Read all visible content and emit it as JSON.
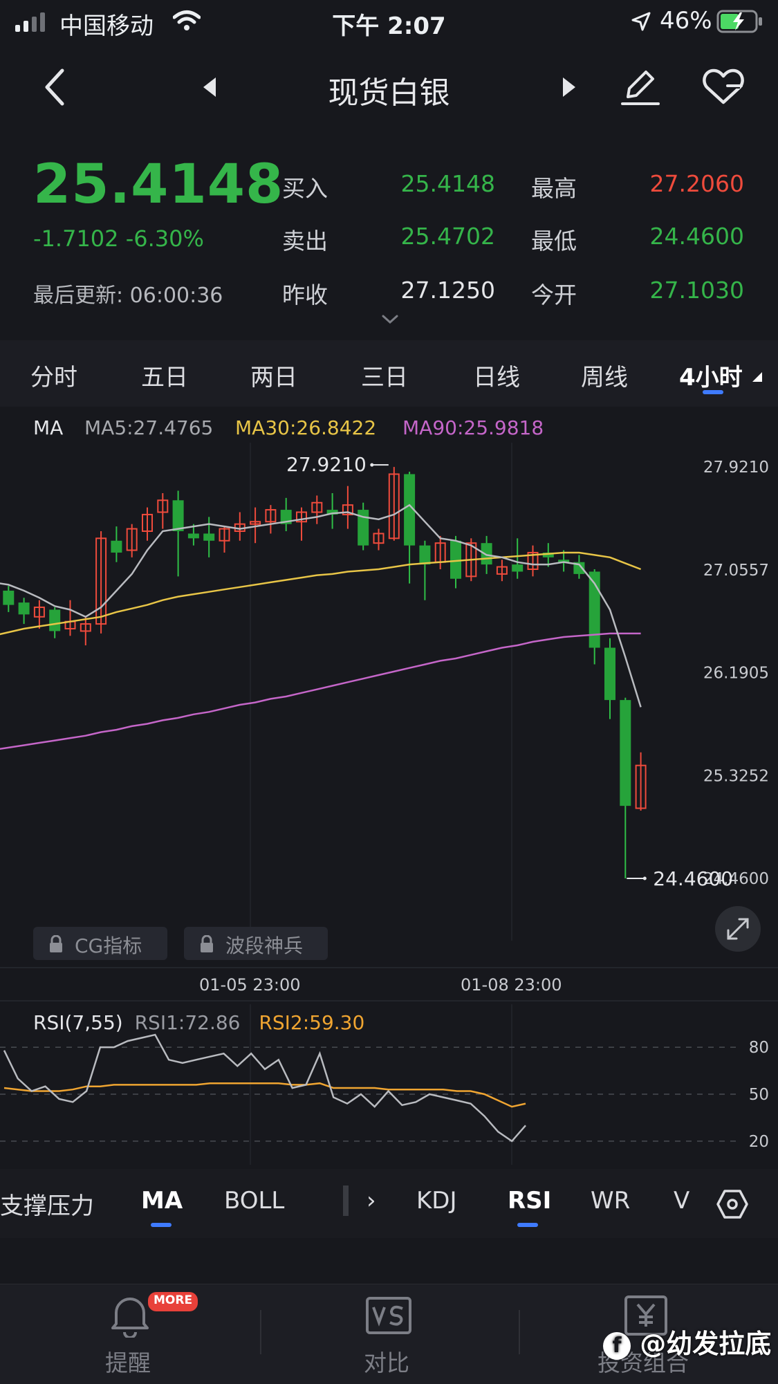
{
  "status_bar": {
    "carrier": "中国移动",
    "time": "下午 2:07",
    "battery": "46%"
  },
  "nav": {
    "title": "现货白银"
  },
  "quote": {
    "price": "25.4148",
    "change": "-1.7102",
    "change_pct": "-6.30%",
    "last_update_label": "最后更新:",
    "last_update_time": "06:00:36",
    "rows": [
      {
        "l1": "买入",
        "v1": "25.4148",
        "c1": "#35b54a",
        "l2": "最高",
        "v2": "27.2060",
        "c2": "#ef4b3c"
      },
      {
        "l1": "卖出",
        "v1": "25.4702",
        "c1": "#35b54a",
        "l2": "最低",
        "v2": "24.4600",
        "c2": "#35b54a"
      },
      {
        "l1": "昨收",
        "v1": "27.1250",
        "c1": "#e6e7ea",
        "l2": "今开",
        "v2": "27.1030",
        "c2": "#35b54a"
      }
    ]
  },
  "tabs": [
    "分时",
    "五日",
    "两日",
    "三日",
    "日线",
    "周线",
    "4小时"
  ],
  "ma_legend": {
    "label": "MA",
    "ma5": "MA5:27.4765",
    "ma30": "MA30:26.8422",
    "ma90": "MA90:25.9818",
    "colors": {
      "ma5": "#b9bbc0",
      "ma30": "#e8c547",
      "ma90": "#c566c9"
    }
  },
  "chart_data": {
    "type": "candlestick",
    "y_ticks": [
      "27.9210",
      "27.0557",
      "26.1905",
      "25.3252",
      "24.4600"
    ],
    "max_label": "27.9210",
    "min_label": "24.4600",
    "x_labels": [
      "01-05 23:00",
      "01-08 23:00"
    ],
    "up_color": "#ef4b3c",
    "down_color": "#26a33a",
    "candles": [
      [
        27.04,
        27.06,
        26.78,
        26.88
      ],
      [
        26.88,
        26.92,
        26.7,
        26.76
      ],
      [
        26.78,
        26.82,
        26.6,
        26.68
      ],
      [
        26.66,
        26.8,
        26.56,
        26.74
      ],
      [
        26.72,
        26.74,
        26.48,
        26.54
      ],
      [
        26.56,
        26.8,
        26.5,
        26.62
      ],
      [
        26.54,
        26.66,
        26.42,
        26.6
      ],
      [
        26.6,
        27.38,
        26.52,
        27.32
      ],
      [
        27.3,
        27.42,
        27.12,
        27.2
      ],
      [
        27.22,
        27.44,
        27.16,
        27.4
      ],
      [
        27.38,
        27.58,
        27.3,
        27.52
      ],
      [
        27.54,
        27.7,
        27.4,
        27.64
      ],
      [
        27.64,
        27.72,
        27.0,
        27.38
      ],
      [
        27.36,
        27.44,
        27.26,
        27.32
      ],
      [
        27.36,
        27.5,
        27.16,
        27.3
      ],
      [
        27.3,
        27.42,
        27.2,
        27.4
      ],
      [
        27.38,
        27.54,
        27.3,
        27.44
      ],
      [
        27.44,
        27.58,
        27.28,
        27.46
      ],
      [
        27.46,
        27.6,
        27.36,
        27.56
      ],
      [
        27.56,
        27.66,
        27.38,
        27.44
      ],
      [
        27.46,
        27.58,
        27.3,
        27.54
      ],
      [
        27.54,
        27.68,
        27.44,
        27.62
      ],
      [
        27.56,
        27.7,
        27.4,
        27.52
      ],
      [
        27.52,
        27.76,
        27.4,
        27.6
      ],
      [
        27.56,
        27.62,
        27.22,
        27.26
      ],
      [
        27.28,
        27.4,
        27.22,
        27.36
      ],
      [
        27.32,
        27.92,
        27.3,
        27.86
      ],
      [
        27.86,
        27.88,
        26.94,
        27.26
      ],
      [
        27.26,
        27.3,
        26.8,
        27.1
      ],
      [
        27.12,
        27.34,
        27.06,
        27.28
      ],
      [
        27.3,
        27.34,
        26.9,
        26.98
      ],
      [
        27.0,
        27.32,
        26.96,
        27.28
      ],
      [
        27.28,
        27.34,
        27.02,
        27.1
      ],
      [
        27.02,
        27.14,
        26.96,
        27.08
      ],
      [
        27.1,
        27.32,
        26.98,
        27.04
      ],
      [
        27.06,
        27.26,
        27.0,
        27.2
      ],
      [
        27.2,
        27.28,
        27.08,
        27.16
      ],
      [
        27.14,
        27.22,
        27.04,
        27.12
      ],
      [
        27.12,
        27.18,
        26.98,
        27.02
      ],
      [
        27.04,
        27.06,
        26.26,
        26.4
      ],
      [
        26.4,
        26.48,
        25.8,
        25.96
      ],
      [
        25.96,
        25.98,
        24.46,
        25.07
      ],
      [
        25.05,
        25.52,
        25.03,
        25.41
      ]
    ],
    "ma5": [
      26.95,
      26.93,
      26.88,
      26.82,
      26.75,
      26.72,
      26.66,
      26.74,
      26.88,
      27.02,
      27.22,
      27.38,
      27.4,
      27.42,
      27.44,
      27.42,
      27.4,
      27.42,
      27.44,
      27.46,
      27.48,
      27.5,
      27.53,
      27.54,
      27.5,
      27.48,
      27.52,
      27.6,
      27.46,
      27.32,
      27.3,
      27.26,
      27.18,
      27.16,
      27.12,
      27.1,
      27.1,
      27.12,
      27.1,
      26.94,
      26.72,
      26.32,
      25.9
    ],
    "ma30": [
      26.5,
      26.53,
      26.56,
      26.58,
      26.6,
      26.62,
      26.64,
      26.66,
      26.7,
      26.73,
      26.76,
      26.8,
      26.83,
      26.85,
      26.87,
      26.89,
      26.91,
      26.93,
      26.95,
      26.97,
      26.99,
      27.01,
      27.02,
      27.04,
      27.05,
      27.06,
      27.08,
      27.1,
      27.11,
      27.12,
      27.13,
      27.14,
      27.15,
      27.16,
      27.17,
      27.18,
      27.19,
      27.2,
      27.2,
      27.18,
      27.16,
      27.11,
      27.06
    ],
    "ma90": [
      25.54,
      25.56,
      25.58,
      25.6,
      25.62,
      25.64,
      25.66,
      25.69,
      25.71,
      25.74,
      25.76,
      25.79,
      25.81,
      25.84,
      25.86,
      25.89,
      25.92,
      25.94,
      25.97,
      25.99,
      26.02,
      26.05,
      26.08,
      26.11,
      26.14,
      26.17,
      26.2,
      26.23,
      26.26,
      26.29,
      26.31,
      26.34,
      26.37,
      26.4,
      26.42,
      26.45,
      26.47,
      26.49,
      26.5,
      26.51,
      26.52,
      26.52,
      26.52
    ]
  },
  "chart_badges": {
    "cg": "CG指标",
    "wave": "波段神兵"
  },
  "rsi": {
    "label": "RSI(7,55)",
    "rsi1": "RSI1:72.86",
    "rsi2": "RSI2:59.30",
    "levels": [
      "80",
      "50",
      "20"
    ],
    "rsi1_color": "#b9bbc0",
    "rsi2_color": "#f0a531",
    "rsi1_values": [
      78,
      60,
      52,
      55,
      47,
      45,
      52,
      80,
      80,
      84,
      86,
      88,
      72,
      70,
      72,
      74,
      76,
      68,
      76,
      66,
      72,
      54,
      56,
      76,
      48,
      44,
      50,
      42,
      52,
      43,
      45,
      50,
      48,
      46,
      44,
      36,
      26,
      20,
      30
    ],
    "rsi2_values": [
      54,
      53,
      52,
      52,
      52,
      53,
      55,
      55,
      56,
      56,
      56,
      56,
      56,
      56,
      56,
      57,
      57,
      57,
      57,
      57,
      57,
      56,
      56,
      57,
      54,
      54,
      54,
      54,
      53,
      53,
      53,
      53,
      53,
      52,
      52,
      50,
      46,
      42,
      44
    ]
  },
  "indicator_tabs": [
    "支撑压力",
    "MA",
    "BOLL",
    "KDJ",
    "RSI",
    "WR",
    "V"
  ],
  "bottom_bar": {
    "alert": "提醒",
    "more_badge": "MORE",
    "compare": "对比",
    "portfolio": "投资组合",
    "watermark": "@幼发拉底"
  }
}
